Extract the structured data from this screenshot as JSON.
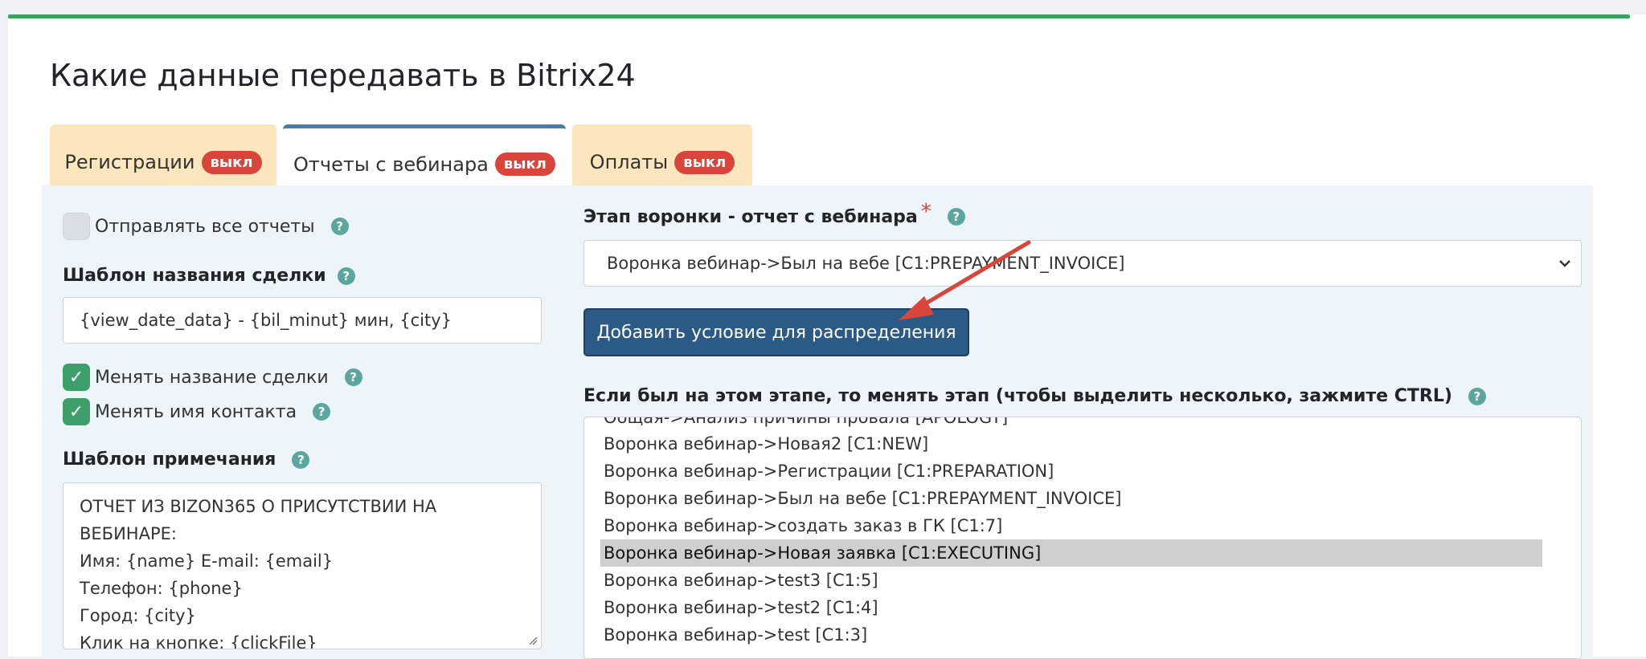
{
  "page": {
    "title": "Какие данные передавать в Bitrix24"
  },
  "tabs": [
    {
      "label": "Регистрации",
      "badge": "выкл"
    },
    {
      "label": "Отчеты с вебинара",
      "badge": "выкл"
    },
    {
      "label": "Оплаты",
      "badge": "выкл"
    }
  ],
  "left": {
    "send_all_label": "Отправлять все отчеты",
    "deal_template_label": "Шаблон названия сделки",
    "deal_template_value": "{view_date_data}  - {bil_minut} мин, {city}",
    "change_deal_name_label": "Менять название сделки",
    "change_contact_name_label": "Менять имя контакта",
    "note_template_label": "Шаблон примечания",
    "note_lines": [
      "ОТЧЕТ ИЗ BIZON365 О ПРИСУТСТВИИ НА",
      "ВЕБИНАРЕ:",
      "Имя: {name} E-mail: {email}",
      "Телефон: {phone}",
      "Город: {city}",
      "Клик на кнопке: {clickFile}"
    ]
  },
  "right": {
    "stage_label": "Этап воронки - отчет с вебинара",
    "required_mark": "*",
    "stage_value": "Воронка вебинар->Был на вебе [C1:PREPAYMENT_INVOICE]",
    "add_condition_button": "Добавить условие для распределения",
    "change_stage_label": "Если был на этом этапе, то менять этап (чтобы выделить несколько, зажмите CTRL)",
    "options": [
      "Общая->Анализ причины провала [APOLOGY]",
      "Воронка вебинар->Новая2 [C1:NEW]",
      "Воронка вебинар->Регистрации [C1:PREPARATION]",
      "Воронка вебинар->Был на вебе [C1:PREPAYMENT_INVOICE]",
      "Воронка вебинар->создать заказ в ГК [C1:7]",
      "Воронка вебинар->Новая заявка [C1:EXECUTING]",
      "Воронка вебинар->test3 [C1:5]",
      "Воронка вебинар->test2 [C1:4]",
      "Воронка вебинар->test [C1:3]"
    ],
    "selected_option": "Воронка вебинар->Новая заявка [C1:EXECUTING]"
  },
  "help_glyph": "?",
  "check_glyph": "✓",
  "colors": {
    "accent_green": "#3ca35c",
    "badge_red": "#d9453a",
    "tab_inactive": "#fbe6bd",
    "button_blue": "#2b5a86",
    "annotation_arrow": "#d9453a"
  }
}
